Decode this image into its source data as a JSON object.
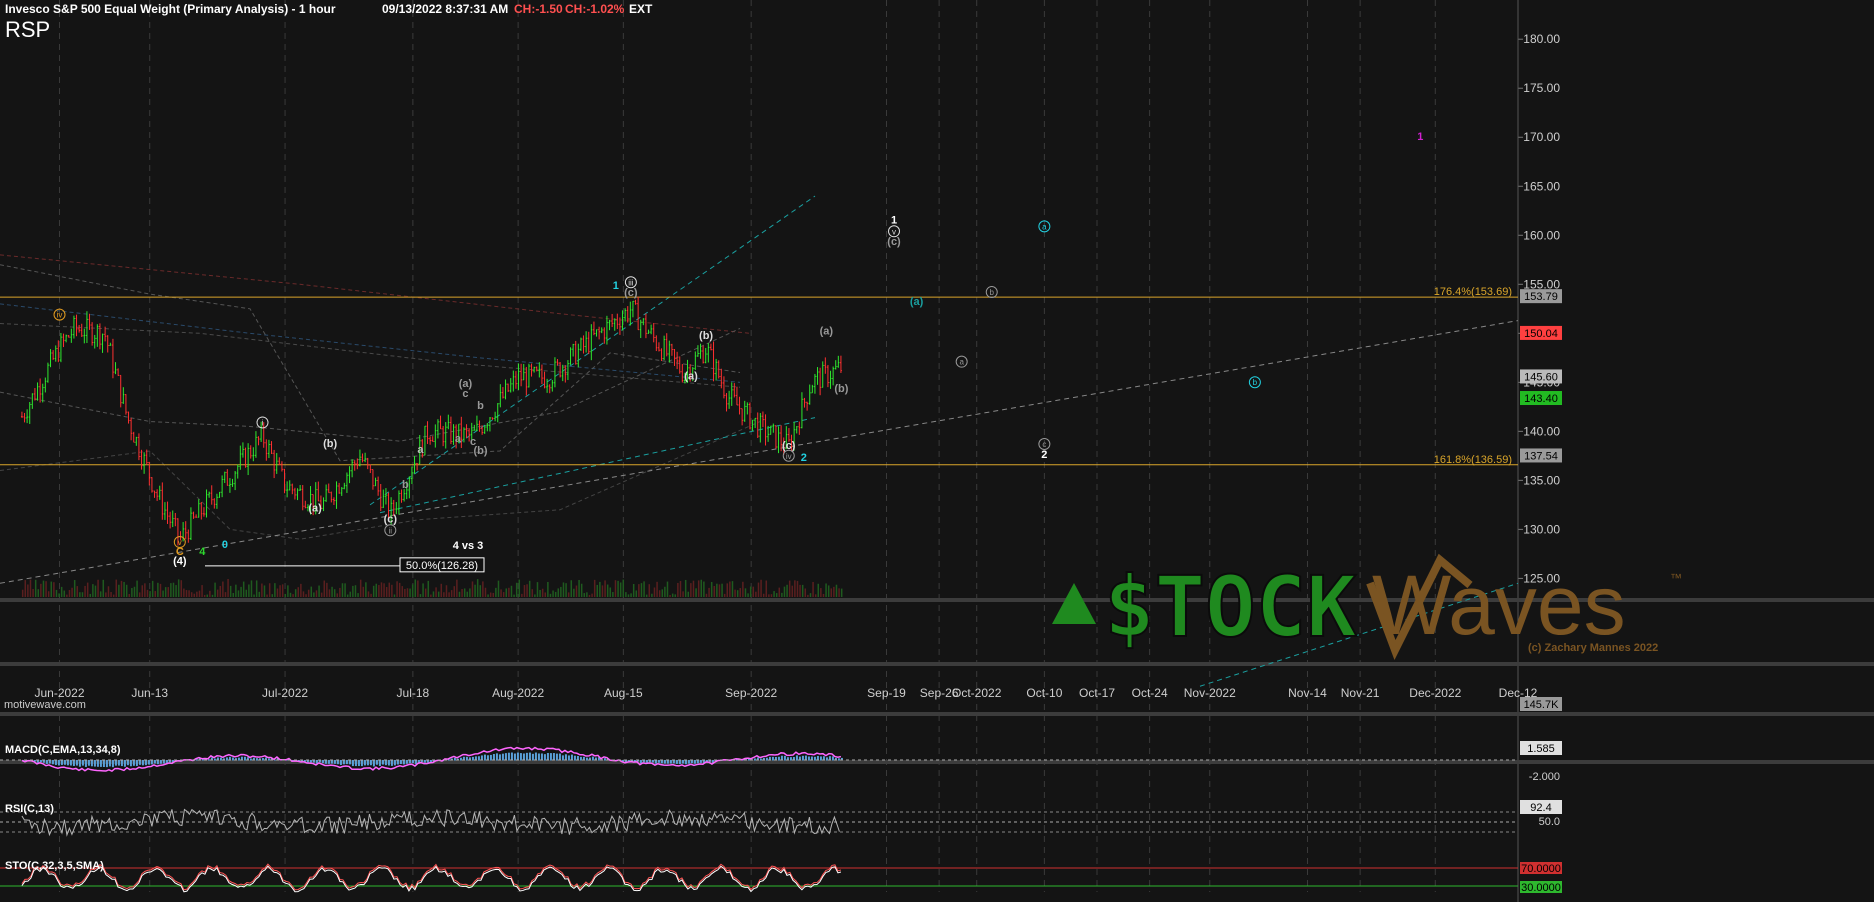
{
  "header": {
    "title": "Invesco S&P 500 Equal Weight (Primary Analysis) - 1 hour",
    "datetime": "09/13/2022 8:37:31 AM",
    "change": "CH:-1.50",
    "change_pct": "CH:-1.02%",
    "session": "EXT",
    "symbol": "RSP"
  },
  "colors": {
    "background": "#141414",
    "up_bar": "#2ee82e",
    "down_bar": "#ff3030",
    "fib_line": "#d9a52a",
    "macd_line": "#ff66ff",
    "macd_hist": "#5aa0d8",
    "stoch_line": "#ff5555",
    "trend_cyan": "#1aa0a0",
    "wave_cyan": "#22d0e0",
    "wave_orange": "#e09a20",
    "wave_green": "#2ed82e",
    "wave_magenta": "#d020d0",
    "logo_green": "#1f8a1f",
    "logo_brown": "#7a5422"
  },
  "chart_data": {
    "type": "candlestick",
    "interval": "1 hour",
    "ylim": [
      123,
      184
    ],
    "y_ticks": [
      "180.00",
      "175.00",
      "170.00",
      "165.00",
      "160.00",
      "155.00",
      "150.00",
      "145.00",
      "140.00",
      "135.00",
      "130.00",
      "125.00"
    ],
    "x_ticks": [
      "Jun-2022",
      "Jun-13",
      "Jul-2022",
      "Jul-18",
      "Aug-2022",
      "Aug-15",
      "Sep-2022",
      "Sep-19",
      "Sep-26",
      "Oct-2022",
      "Oct-10",
      "Oct-17",
      "Oct-24",
      "Nov-2022",
      "Nov-14",
      "Nov-21",
      "Dec-2022",
      "Dec-12"
    ],
    "price_path": [
      {
        "date": "2022-05-27",
        "price": 141.5
      },
      {
        "date": "2022-06-01",
        "price": 148.5
      },
      {
        "date": "2022-06-03",
        "price": 150.5
      },
      {
        "date": "2022-06-07",
        "price": 150.0
      },
      {
        "date": "2022-06-10",
        "price": 141.5
      },
      {
        "date": "2022-06-14",
        "price": 133.5
      },
      {
        "date": "2022-06-17",
        "price": 129.0
      },
      {
        "date": "2022-06-21",
        "price": 133.0
      },
      {
        "date": "2022-06-28",
        "price": 139.5
      },
      {
        "date": "2022-07-01",
        "price": 134.5
      },
      {
        "date": "2022-07-06",
        "price": 132.5
      },
      {
        "date": "2022-07-11",
        "price": 137.5
      },
      {
        "date": "2022-07-15",
        "price": 131.5
      },
      {
        "date": "2022-07-20",
        "price": 140.0
      },
      {
        "date": "2022-07-26",
        "price": 139.5
      },
      {
        "date": "2022-08-01",
        "price": 145.5
      },
      {
        "date": "2022-08-05",
        "price": 145.5
      },
      {
        "date": "2022-08-11",
        "price": 149.5
      },
      {
        "date": "2022-08-16",
        "price": 152.5
      },
      {
        "date": "2022-08-19",
        "price": 149.5
      },
      {
        "date": "2022-08-23",
        "price": 146.0
      },
      {
        "date": "2022-08-26",
        "price": 148.5
      },
      {
        "date": "2022-08-29",
        "price": 143.5
      },
      {
        "date": "2022-09-02",
        "price": 140.5
      },
      {
        "date": "2022-09-06",
        "price": 138.5
      },
      {
        "date": "2022-09-09",
        "price": 145.0
      },
      {
        "date": "2022-09-13",
        "price": 146.5
      }
    ],
    "price_boxes": [
      {
        "label": "153.79",
        "price": 153.79,
        "color": "#9a9a9a"
      },
      {
        "label": "150.04",
        "price": 150.04,
        "color": "#ff4040"
      },
      {
        "label": "145.60",
        "price": 145.6,
        "color": "#bbbbbb"
      },
      {
        "label": "143.40",
        "price": 143.4,
        "color": "#22bb22"
      },
      {
        "label": "137.54",
        "price": 137.54,
        "color": "#9a9a9a"
      },
      {
        "label": "145.7K",
        "price": 124.0,
        "color": "#9a9a9a"
      }
    ],
    "fib_levels": [
      {
        "label": "176.4%(153.69)",
        "price": 153.69
      },
      {
        "label": "161.8%(136.59)",
        "price": 136.59
      }
    ],
    "retracement": {
      "label": "50.0%(126.28)",
      "price": 126.28
    },
    "note": "4 vs 3",
    "wave_labels": [
      {
        "text": "iv",
        "date": "2022-06-01",
        "price": 151.5,
        "color": "#e09a20",
        "circled": true
      },
      {
        "text": "v",
        "date": "2022-06-17",
        "price": 128.3,
        "color": "#e09a20",
        "circled": true
      },
      {
        "text": "C",
        "date": "2022-06-17",
        "price": 127.4,
        "color": "#e09a20",
        "circled": false
      },
      {
        "text": "(4)",
        "date": "2022-06-17",
        "price": 126.4,
        "color": "#ffffff",
        "circled": false
      },
      {
        "text": "4",
        "date": "2022-06-20",
        "price": 127.4,
        "color": "#2ed82e",
        "circled": false
      },
      {
        "text": "0",
        "date": "2022-06-23",
        "price": 128.1,
        "color": "#22d0e0",
        "circled": false
      },
      {
        "text": "i",
        "date": "2022-06-28",
        "price": 140.5,
        "color": "#dddddd",
        "circled": true
      },
      {
        "text": "(a)",
        "date": "2022-07-05",
        "price": 131.8,
        "color": "#dddddd",
        "circled": false
      },
      {
        "text": "(b)",
        "date": "2022-07-07",
        "price": 138.4,
        "color": "#dddddd",
        "circled": false
      },
      {
        "text": "(c)",
        "date": "2022-07-15",
        "price": 130.7,
        "color": "#dddddd",
        "circled": false
      },
      {
        "text": "ii",
        "date": "2022-07-15",
        "price": 129.5,
        "color": "#999999",
        "circled": true
      },
      {
        "text": "a",
        "date": "2022-07-19",
        "price": 137.8,
        "color": "#bbbbbb",
        "circled": false
      },
      {
        "text": "b",
        "date": "2022-07-17",
        "price": 134.2,
        "color": "#999999",
        "circled": false
      },
      {
        "text": "(a)",
        "date": "2022-07-25",
        "price": 144.5,
        "color": "#999999",
        "circled": false
      },
      {
        "text": "c",
        "date": "2022-07-25",
        "price": 143.5,
        "color": "#999999",
        "circled": false
      },
      {
        "text": "b",
        "date": "2022-07-27",
        "price": 142.3,
        "color": "#999999",
        "circled": false
      },
      {
        "text": "a",
        "date": "2022-07-24",
        "price": 138.9,
        "color": "#999999",
        "circled": false
      },
      {
        "text": "c",
        "date": "2022-07-26",
        "price": 138.6,
        "color": "#999999",
        "circled": false
      },
      {
        "text": "(b)",
        "date": "2022-07-27",
        "price": 137.7,
        "color": "#999999",
        "circled": false
      },
      {
        "text": "1",
        "date": "2022-08-14",
        "price": 154.5,
        "color": "#22d0e0",
        "circled": false
      },
      {
        "text": "iii",
        "date": "2022-08-16",
        "price": 154.8,
        "color": "#dddddd",
        "circled": true
      },
      {
        "text": "(c)",
        "date": "2022-08-16",
        "price": 153.8,
        "color": "#999999",
        "circled": false
      },
      {
        "text": "(b)",
        "date": "2022-08-26",
        "price": 149.4,
        "color": "#dddddd",
        "circled": false
      },
      {
        "text": "(a)",
        "date": "2022-08-24",
        "price": 145.3,
        "color": "#dddddd",
        "circled": false
      },
      {
        "text": "(c)",
        "date": "2022-09-06",
        "price": 138.2,
        "color": "#dddddd",
        "circled": false
      },
      {
        "text": "iv",
        "date": "2022-09-06",
        "price": 137.1,
        "color": "#999999",
        "circled": true
      },
      {
        "text": "2",
        "date": "2022-09-08",
        "price": 137.0,
        "color": "#22d0e0",
        "circled": false
      },
      {
        "text": "(a)",
        "date": "2022-09-11",
        "price": 149.9,
        "color": "#999999",
        "circled": false
      },
      {
        "text": "(b)",
        "date": "2022-09-13",
        "price": 144.0,
        "color": "#999999",
        "circled": false
      },
      {
        "text": "1",
        "date": "2022-09-20",
        "price": 161.2,
        "color": "#ffffff",
        "circled": false
      },
      {
        "text": "v",
        "date": "2022-09-20",
        "price": 160.0,
        "color": "#dddddd",
        "circled": true
      },
      {
        "text": "(c)",
        "date": "2022-09-20",
        "price": 159.0,
        "color": "#999999",
        "circled": false
      },
      {
        "text": "(a)",
        "date": "2022-09-23",
        "price": 152.9,
        "color": "#1aa0a0",
        "circled": false
      },
      {
        "text": "a",
        "date": "2022-09-29",
        "price": 146.7,
        "color": "#999999",
        "circled": true
      },
      {
        "text": "b",
        "date": "2022-10-03",
        "price": 153.8,
        "color": "#999999",
        "circled": true
      },
      {
        "text": "c",
        "date": "2022-10-10",
        "price": 138.3,
        "color": "#999999",
        "circled": true
      },
      {
        "text": "2",
        "date": "2022-10-10",
        "price": 137.3,
        "color": "#ffffff",
        "circled": false
      },
      {
        "text": "a",
        "date": "2022-10-10",
        "price": 160.5,
        "color": "#22d0e0",
        "circled": true
      },
      {
        "text": "b",
        "date": "2022-11-07",
        "price": 144.6,
        "color": "#22d0e0",
        "circled": true
      },
      {
        "text": "1",
        "date": "2022-11-29",
        "price": 169.7,
        "color": "#d020d0",
        "circled": false
      }
    ]
  },
  "indicators": {
    "macd": {
      "label": "MACD(C,EMA,13,34,8)",
      "value_box": "1.585",
      "tick": "-2.000"
    },
    "rsi": {
      "label": "RSI(C,13)",
      "value_box": "92.4",
      "tick": "50.0"
    },
    "stoch": {
      "label": "STO(C,32,3,5,SMA)",
      "box_upper": "70.0000",
      "box_lower": "30.0000"
    }
  },
  "logo": {
    "left_text": "$TOCK",
    "right_text": "Waves",
    "trademark": "™",
    "copyright": "(c) Zachary Mannes 2022"
  },
  "watermark": "motivewave.com"
}
